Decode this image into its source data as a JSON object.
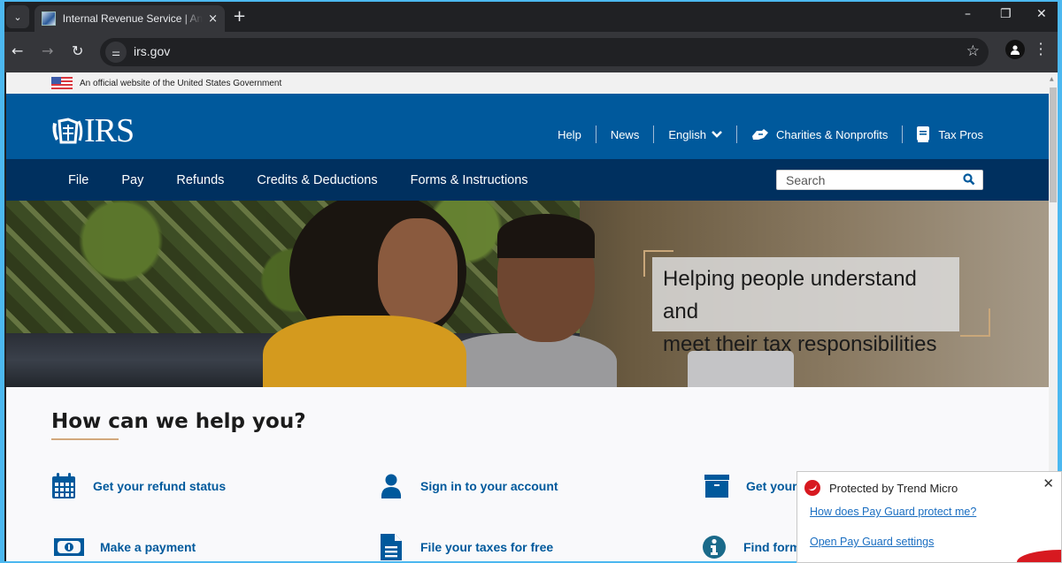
{
  "browser": {
    "tab": {
      "title": "Internal Revenue Service | An official website of the United States Government",
      "close_icon": "×"
    },
    "new_tab_label": "+",
    "window_controls": {
      "minimize": "–",
      "restore": "❐",
      "close": "✕"
    },
    "nav": {
      "back": "←",
      "forward": "→",
      "reload": "↻"
    },
    "url": "irs.gov",
    "star_icon": "☆"
  },
  "page": {
    "gov_banner": "An official website of the United States Government",
    "logo_text": "IRS",
    "utility_nav": [
      {
        "label": "Help"
      },
      {
        "label": "News"
      },
      {
        "label": "English"
      },
      {
        "label": "Charities & Nonprofits"
      },
      {
        "label": "Tax Pros"
      }
    ],
    "main_nav": [
      {
        "label": "File"
      },
      {
        "label": "Pay"
      },
      {
        "label": "Refunds"
      },
      {
        "label": "Credits & Deductions"
      },
      {
        "label": "Forms & Instructions"
      }
    ],
    "search": {
      "placeholder": "Search"
    },
    "hero": {
      "tagline_line1": "Helping people understand and",
      "tagline_line2": "meet their tax responsibilities"
    },
    "help": {
      "title": "How can we help you?",
      "items": [
        {
          "label": "Get your refund status",
          "icon": "calendar-icon"
        },
        {
          "label": "Sign in to your account",
          "icon": "user-icon"
        },
        {
          "label": "Get your",
          "icon": "archive-box-icon"
        },
        {
          "label": "Make a payment",
          "icon": "money-icon"
        },
        {
          "label": "File your taxes for free",
          "icon": "document-icon"
        },
        {
          "label": "Find form",
          "icon": "info-icon"
        }
      ]
    },
    "colors": {
      "header_blue": "#00599c",
      "nav_navy": "#00305f",
      "accent_tan": "#d2a87c",
      "link_blue": "#00599c"
    }
  },
  "trend_popup": {
    "title": "Protected by Trend Micro",
    "link1": "How does Pay Guard protect me?",
    "link2": "Open Pay Guard settings",
    "close_icon": "✕"
  }
}
